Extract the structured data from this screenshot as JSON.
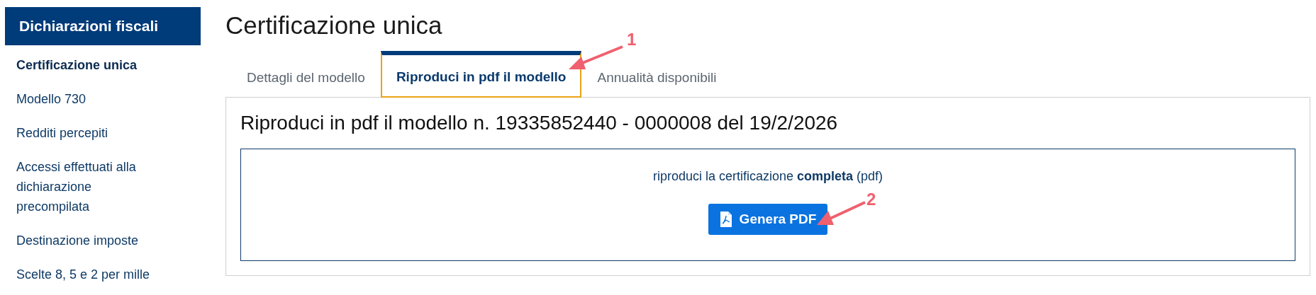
{
  "sidebar": {
    "title": "Dichiarazioni fiscali",
    "items": [
      {
        "label": "Certificazione unica",
        "selected": true
      },
      {
        "label": "Modello 730",
        "selected": false
      },
      {
        "label": "Redditi percepiti",
        "selected": false
      },
      {
        "label": "Accessi effettuati alla dichiarazione precompilata",
        "selected": false
      },
      {
        "label": "Destinazione imposte",
        "selected": false
      },
      {
        "label": "Scelte 8, 5 e 2 per mille",
        "selected": false
      }
    ]
  },
  "page_title": "Certificazione unica",
  "tabs": [
    {
      "label": "Dettagli del modello",
      "selected": false
    },
    {
      "label": "Riproduci in pdf il modello",
      "selected": true
    },
    {
      "label": "Annualità disponibili",
      "selected": false
    }
  ],
  "panel": {
    "heading": "Riproduci in pdf il modello n. 19335852440 - 0000008 del 19/2/2026",
    "description": "riproduci la certificazione **completa** (pdf)",
    "button": "Genera PDF"
  },
  "annotations": [
    {
      "label": "1"
    },
    {
      "label": "2"
    }
  ]
}
